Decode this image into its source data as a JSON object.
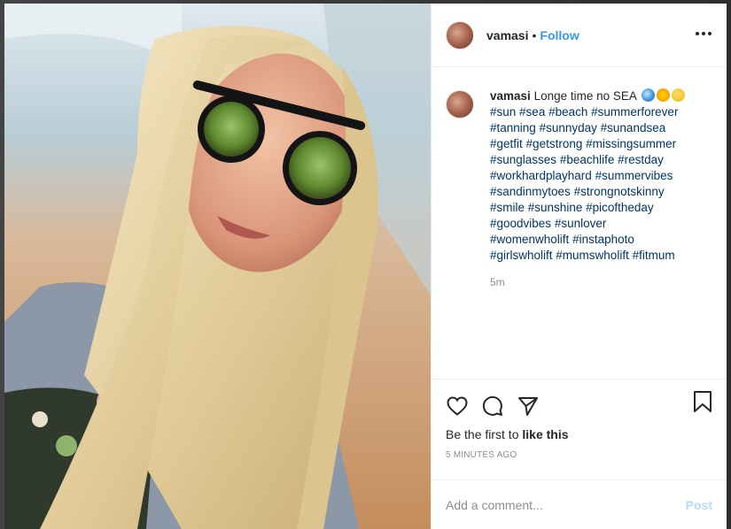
{
  "post": {
    "username": "vamasi",
    "separator": "•",
    "follow_label": "Follow",
    "more_icon": "more-horizontal-icon",
    "caption_text": "Longe time no SEA",
    "caption_emojis": [
      "water-wave-emoji",
      "sun-emoji",
      "grinning-face-emoji"
    ],
    "hashtag_lines": [
      [
        "#sun",
        "#sea",
        "#beach",
        "#summerforever"
      ],
      [
        "#tanning",
        "#sunnyday",
        "#sunandsea"
      ],
      [
        "#getfit",
        "#getstrong",
        "#missingsummer"
      ],
      [
        "#sunglasses",
        "#beachlife",
        "#restday"
      ],
      [
        "#workhardplayhard",
        "#summervibes"
      ],
      [
        "#sandinmytoes",
        "#strongnotskinny"
      ],
      [
        "#smile",
        "#sunshine",
        "#picoftheday"
      ],
      [
        "#goodvibes",
        "#sunlover"
      ],
      [
        "#womenwholift",
        "#instaphoto"
      ],
      [
        "#girlswholift",
        "#mumswholift",
        "#fitmum"
      ]
    ],
    "caption_time": "5m",
    "likes_prefix": "Be the first to ",
    "likes_action": "like this",
    "timestamp": "5 MINUTES AGO",
    "comment_placeholder": "Add a comment...",
    "post_label": "Post"
  },
  "icons": {
    "like": "heart-icon",
    "comment": "comment-bubble-icon",
    "share": "paper-plane-icon",
    "save": "bookmark-icon"
  },
  "colors": {
    "link": "#3897f0",
    "hashtag": "#003569",
    "muted": "#8e8e8e",
    "post_disabled": "#b3dbff"
  }
}
